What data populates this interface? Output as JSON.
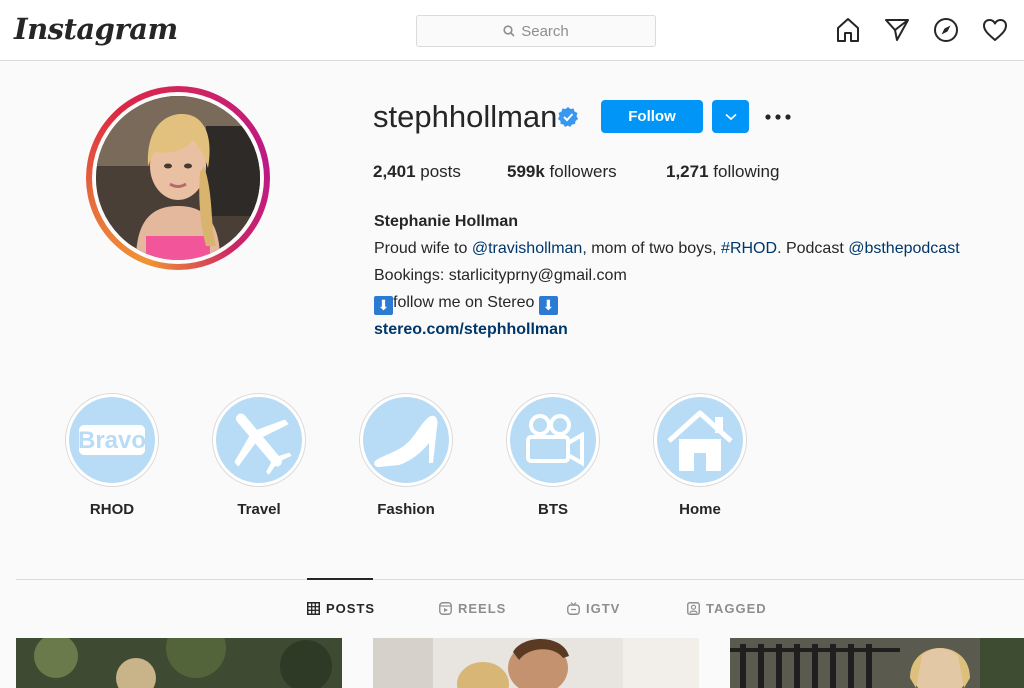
{
  "app": {
    "logo": "Instagram"
  },
  "search": {
    "placeholder": "Search"
  },
  "nav": {
    "icons": [
      "home-icon",
      "direct-icon",
      "explore-icon",
      "activity-heart-icon"
    ]
  },
  "profile": {
    "username": "stephhollman",
    "verified": true,
    "follow_label": "Follow",
    "stats": {
      "posts_count": "2,401",
      "posts_label": " posts",
      "followers_count": "599k",
      "followers_label": " followers",
      "following_count": "1,271",
      "following_label": " following"
    },
    "full_name": "Stephanie Hollman",
    "bio": {
      "line1_a": "Proud wife to ",
      "line1_mention": "@travishollman",
      "line1_b": ", mom of two boys, ",
      "line1_hashtag": "#RHOD",
      "line1_c": ". Podcast ",
      "line1_mention2": "@bsthepodcast",
      "line2": "Bookings: starlicityprny@gmail.com",
      "line3_arrow": "⬇",
      "line3_text": "follow me on Stereo ",
      "website": "stereo.com/stephhollman"
    }
  },
  "highlights": [
    {
      "label": "RHOD",
      "icon": "bravo-logo-icon"
    },
    {
      "label": "Travel",
      "icon": "airplane-icon"
    },
    {
      "label": "Fashion",
      "icon": "high-heel-icon"
    },
    {
      "label": "BTS",
      "icon": "video-camera-icon"
    },
    {
      "label": "Home",
      "icon": "house-icon"
    }
  ],
  "highlight_badge_text": "Bravo",
  "tabs": [
    {
      "label": "POSTS",
      "active": true,
      "icon": "grid-icon"
    },
    {
      "label": "REELS",
      "active": false,
      "icon": "reels-icon"
    },
    {
      "label": "IGTV",
      "active": false,
      "icon": "igtv-icon"
    },
    {
      "label": "TAGGED",
      "active": false,
      "icon": "tagged-icon"
    }
  ],
  "colors": {
    "accent": "#0095f6",
    "highlight_bg": "#b9dcf6",
    "link": "#00376b"
  }
}
